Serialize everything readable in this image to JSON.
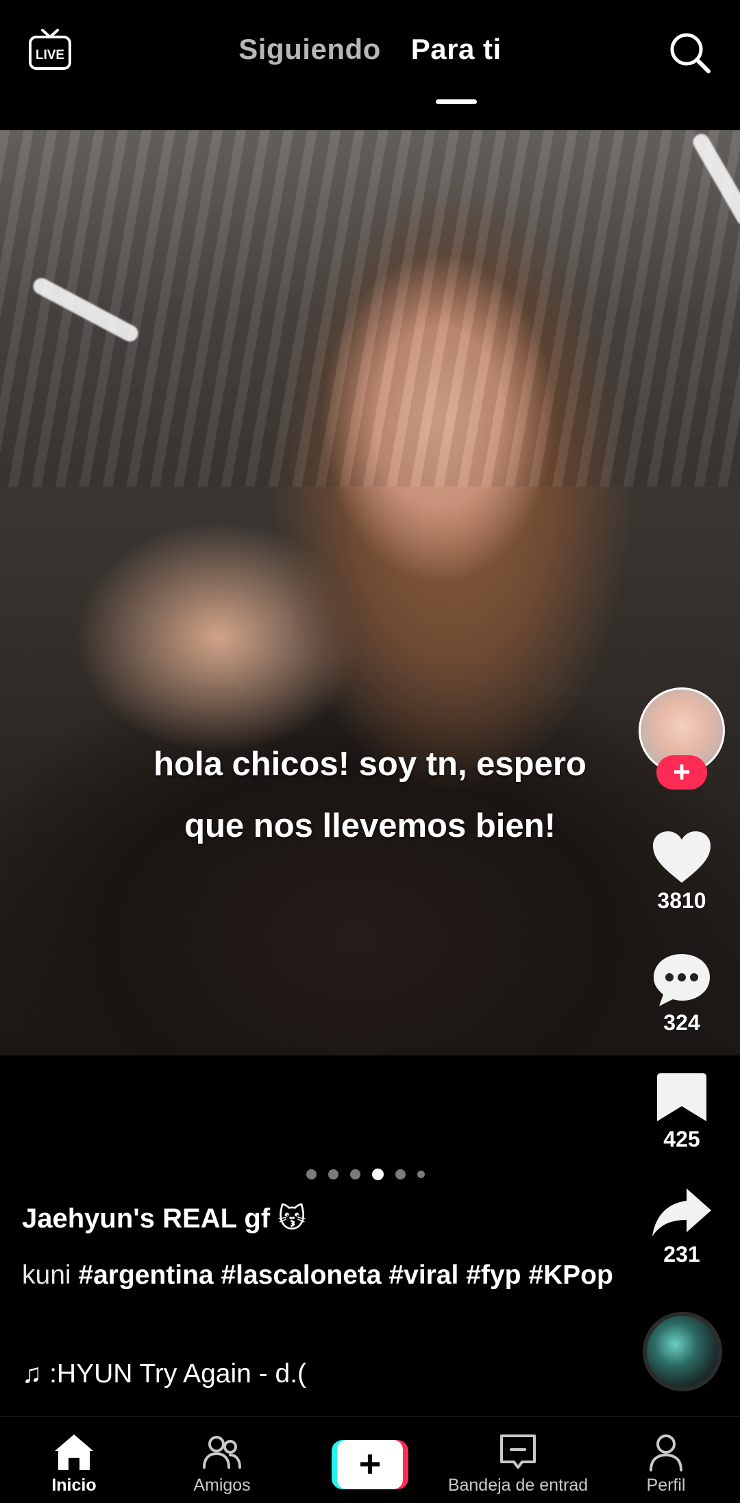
{
  "header": {
    "live_label": "LIVE",
    "tabs": [
      {
        "label": "Siguiendo",
        "active": false
      },
      {
        "label": "Para ti",
        "active": true
      }
    ]
  },
  "post": {
    "caption_line1": "hola chicos! soy tn, espero",
    "caption_line2": "que nos llevemos bien!",
    "username": "Jaehyun's REAL gf 😽",
    "desc_prefix": "kuni",
    "hashtags": [
      "#argentina",
      "#lascaloneta",
      "#viral",
      "#fyp",
      "#KPop"
    ],
    "music": "♫ :HYUN    Try Again - d.(",
    "carousel": {
      "count": 6,
      "active_index": 3
    }
  },
  "actions": {
    "likes": "3810",
    "comments": "324",
    "saves": "425",
    "shares": "231"
  },
  "nav": {
    "home": "Inicio",
    "friends": "Amigos",
    "inbox": "Bandeja de entrad",
    "profile": "Perfil"
  },
  "colors": {
    "accent": "#fe2c55",
    "cyan": "#25f4ee",
    "background": "#000000"
  }
}
